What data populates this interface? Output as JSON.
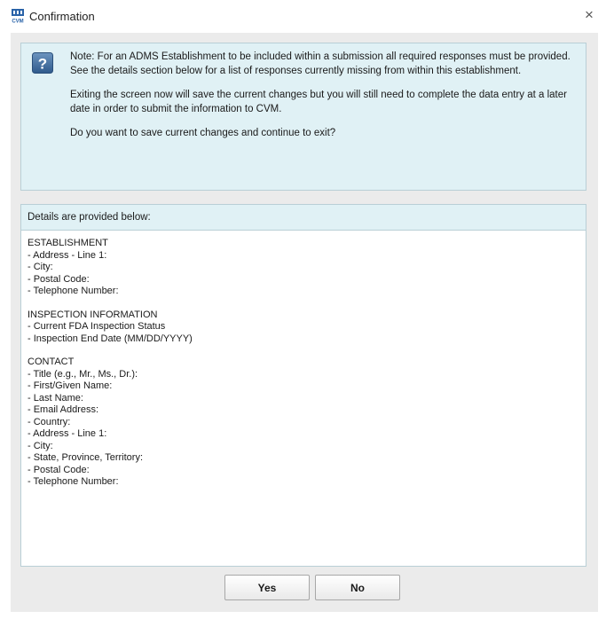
{
  "window": {
    "title": "Confirmation",
    "icon": "adms-cvm-icon",
    "close_label": "×"
  },
  "note": {
    "icon": "question-icon",
    "paragraphs": [
      "Note: For an ADMS Establishment to be included within a submission all required responses must be provided. See the details section below for a list of responses currently missing from within this establishment.",
      "Exiting the screen now will save the current changes but you will still need to complete the data entry at a later date in order to submit the information to CVM.",
      "Do you want to save current changes and continue to exit?"
    ]
  },
  "details": {
    "header": "Details are provided below:",
    "sections": [
      {
        "title": "ESTABLISHMENT",
        "items": [
          "- Address - Line 1:",
          "- City:",
          "- Postal Code:",
          "- Telephone Number:"
        ]
      },
      {
        "title": "INSPECTION INFORMATION",
        "items": [
          "- Current FDA Inspection Status",
          "- Inspection End Date (MM/DD/YYYY)"
        ]
      },
      {
        "title": "CONTACT",
        "items": [
          "- Title (e.g., Mr., Ms., Dr.):",
          "- First/Given Name:",
          "- Last Name:",
          "- Email Address:",
          "- Country:",
          "- Address - Line 1:",
          "- City:",
          "- State, Province, Territory:",
          "- Postal Code:",
          "- Telephone Number:"
        ]
      }
    ]
  },
  "buttons": {
    "yes_label": "Yes",
    "no_label": "No"
  },
  "colors": {
    "panel_bg": "#e0f1f5",
    "client_bg": "#ebebeb"
  }
}
